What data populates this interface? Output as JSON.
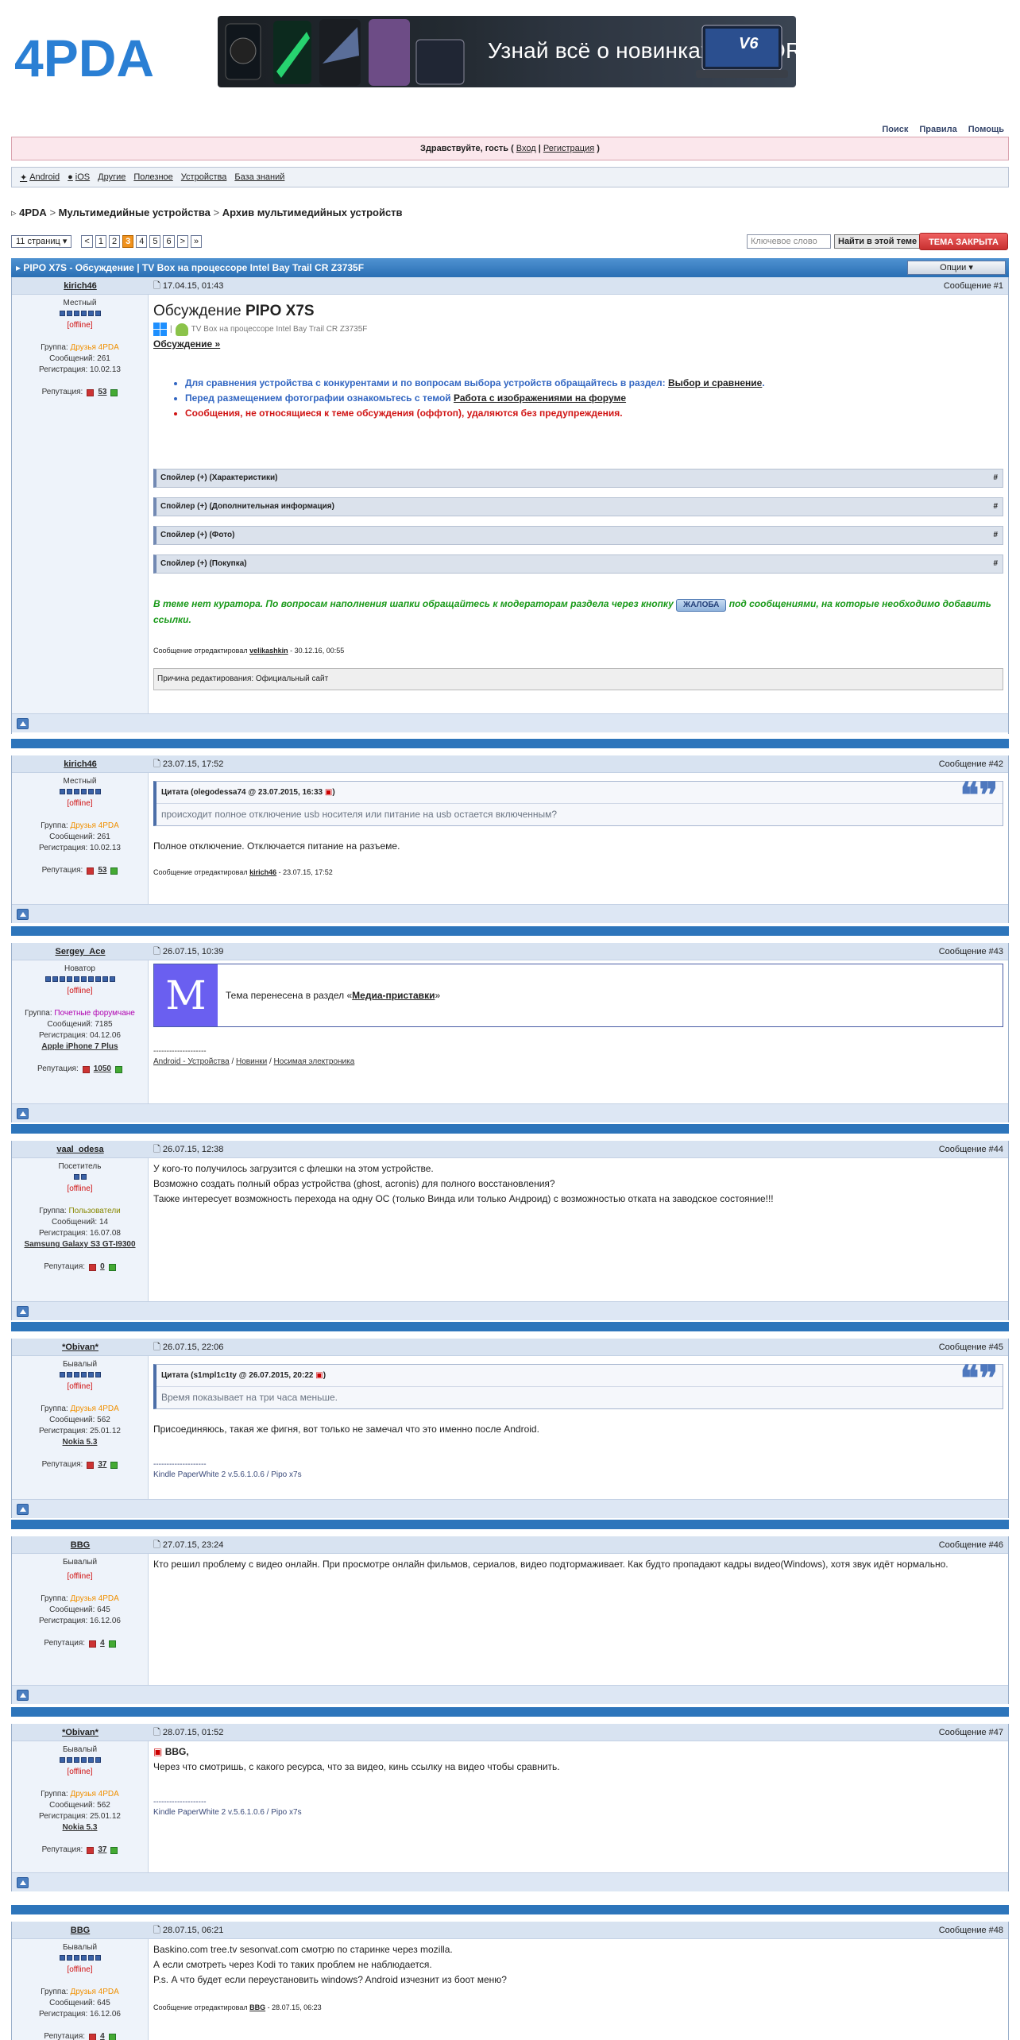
{
  "logo": "4PDA",
  "banner": {
    "text": "Узнай всё о новинках HONOR",
    "badge": "V6"
  },
  "toplinks": [
    "Поиск",
    "Правила",
    "Помощь"
  ],
  "welcome": {
    "prefix": "Здравствуйте, гость ( ",
    "login": "Вход",
    "mid": " | ",
    "register": "Регистрация",
    "suffix": " )"
  },
  "categories": [
    "Android",
    "iOS",
    "Другие",
    "Полезное",
    "Устройства",
    "База знаний"
  ],
  "breadcrumb": [
    "4PDA",
    "Мультимедийные устройства",
    "Архив мультимедийных устройств"
  ],
  "pager": {
    "pages_label": "11 страниц",
    "items": [
      "<",
      "1",
      "2",
      "3",
      "4",
      "5",
      "6",
      ">",
      "»"
    ],
    "current": "3"
  },
  "search": {
    "placeholder": "Ключевое слово",
    "button": "Найти в этой теме"
  },
  "closed_label": "ТЕМА ЗАКРЫТА",
  "topic_title": "PIPO X7S - Обсуждение | TV Box на процессоре Intel Bay Trail CR Z3735F",
  "options_label": "Опции ▾",
  "posts": [
    {
      "user": "kirich46",
      "date": "17.04.15, 01:43",
      "num": "Сообщение #1",
      "rank": "Местный",
      "status": "[offline]",
      "group_label": "Группа: ",
      "group": "Друзья 4PDA",
      "messages": "Сообщений: 261",
      "reg": "Регистрация: 10.02.13",
      "rep_label": "Репутация:",
      "rep": "53",
      "title_plain": "Обсуждение ",
      "title_bold": "PIPO X7S",
      "subtitle": "TV Box на процессоре Intel Bay Trail CR Z3735F",
      "sub_link": "Обсуждение »",
      "bullets": [
        {
          "text": "Для сравнения устройства с конкурентами и по вопросам выбора устройств обращайтесь в раздел: ",
          "link": "Выбор и сравнение",
          "tail": "."
        },
        {
          "text": "Перед размещением фотографии ознакомьтесь с темой ",
          "link": "Работа с изображениями на форуме",
          "tail": ""
        },
        {
          "text": "Сообщения, не относящиеся к теме обсуждения (оффтоп), удаляются без предупреждения.",
          "link": "",
          "tail": ""
        }
      ],
      "spoilers": [
        "Спойлер (+) (Характеристики)",
        "Спойлер (+) (Дополнительная информация)",
        "Спойлер (+) (Фото)",
        "Спойлер (+) (Покупка)"
      ],
      "curator_a": "В теме нет куратора. По вопросам наполнения шапки обращайтесь к модераторам раздела через кнопку ",
      "curator_btn": "ЖАЛОБА",
      "curator_b": " под сообщениями, на которые необходимо добавить ссылки.",
      "edit_prefix": "Сообщение отредактировал ",
      "edit_user": "velikashkin",
      "edit_date": " - 30.12.16, 00:55",
      "reason": "Причина редактирования: Официальный сайт"
    },
    {
      "user": "kirich46",
      "date": "23.07.15, 17:52",
      "num": "Сообщение #42",
      "rank": "Местный",
      "status": "[offline]",
      "group_label": "Группа: ",
      "group": "Друзья 4PDA",
      "messages": "Сообщений: 261",
      "reg": "Регистрация: 10.02.13",
      "rep_label": "Репутация:",
      "rep": "53",
      "quote_head": "Цитата (olegodessa74 @ 23.07.2015, 16:33",
      "quote_body": "происходит полное отключение usb носителя или питание на usb остается включенным?",
      "text": [
        "Полное отключение. Отключается питание на разъеме."
      ],
      "edit_prefix": "Сообщение отредактировал ",
      "edit_user": "kirich46",
      "edit_date": " - 23.07.15, 17:52"
    },
    {
      "user": "Sergey_Ace",
      "date": "26.07.15, 10:39",
      "num": "Сообщение #43",
      "rank": "Новатор",
      "status": "[offline]",
      "group_label": "Группа: ",
      "group": "Почетные форумчане",
      "messages": "Сообщений: 7185",
      "reg": "Регистрация: 04.12.06",
      "device": "Apple iPhone 7 Plus",
      "rep_label": "Репутация:",
      "rep": "1050",
      "moved_letter": "M",
      "moved_text": "Тема перенесена в раздел «",
      "moved_link": "Медиа-приставки",
      "moved_tail": "»",
      "sig_dash": "--------------------",
      "sig_links": [
        "Android - Устройства",
        "Новинки",
        "Носимая электроника"
      ]
    },
    {
      "user": "vaal_odesa",
      "date": "26.07.15, 12:38",
      "num": "Сообщение #44",
      "rank": "Посетитель",
      "status": "[offline]",
      "group_label": "Группа: ",
      "group": "Пользователи",
      "messages": "Сообщений: 14",
      "reg": "Регистрация: 16.07.08",
      "device": "Samsung Galaxy S3 GT-I9300",
      "rep_label": "Репутация:",
      "rep": "0",
      "text": [
        "У кого-то получилось загрузится с флешки на этом устройстве.",
        "Возможно создать полный образ устройства (ghost, acronis) для полного восстановления?",
        "Также интересует возможность перехода на одну ОС (только Винда или только Андроид) с возможностью отката на заводское состояние!!!"
      ]
    },
    {
      "user": "*Obivan*",
      "date": "26.07.15, 22:06",
      "num": "Сообщение #45",
      "rank": "Бывалый",
      "status": "[offline]",
      "group_label": "Группа: ",
      "group": "Друзья 4PDA",
      "messages": "Сообщений: 562",
      "reg": "Регистрация: 25.01.12",
      "device": "Nokia 5.3",
      "rep_label": "Репутация:",
      "rep": "37",
      "quote_head": "Цитата (s1mpl1c1ty @ 26.07.2015, 20:22",
      "quote_body": "Время показывает на три часа меньше.",
      "text": [
        "Присоединяюсь, такая же фигня, вот только не замечал что это именно после Android."
      ],
      "sig_dash": "--------------------",
      "sig": "Kindle PaperWhite 2 v.5.6.1.0.6 / Pipo x7s"
    },
    {
      "user": "BBG",
      "date": "27.07.15, 23:24",
      "num": "Сообщение #46",
      "rank": "Бывалый",
      "status": "[offline]",
      "group_label": "Группа: ",
      "group": "Друзья 4PDA",
      "messages": "Сообщений: 645",
      "reg": "Регистрация: 16.12.06",
      "rep_label": "Репутация:",
      "rep": "4",
      "text": [
        "Кто решил проблему с видео онлайн. При просмотре онлайн фильмов, сериалов, видео подтормаживает. Как будто пропадают кадры видео(Windows), хотя звук идёт нормально."
      ]
    },
    {
      "user": "*Obivan*",
      "date": "28.07.15, 01:52",
      "num": "Сообщение #47",
      "rank": "Бывалый",
      "status": "[offline]",
      "group_label": "Группа: ",
      "group": "Друзья 4PDA",
      "messages": "Сообщений: 562",
      "reg": "Регистрация: 25.01.12",
      "device": "Nokia 5.3",
      "rep_label": "Репутация:",
      "rep": "37",
      "mention": "BBG,",
      "text": [
        "Через что смотришь, с какого ресурса, что за видео, кинь ссылку на видео чтобы сравнить."
      ],
      "sig_dash": "--------------------",
      "sig": "Kindle PaperWhite 2 v.5.6.1.0.6 / Pipo x7s"
    },
    {
      "user": "BBG",
      "date": "28.07.15, 06:21",
      "num": "Сообщение #48",
      "rank": "Бывалый",
      "status": "[offline]",
      "group_label": "Группа: ",
      "group": "Друзья 4PDA",
      "messages": "Сообщений: 645",
      "reg": "Регистрация: 16.12.06",
      "rep_label": "Репутация:",
      "rep": "4",
      "text": [
        "Baskino.com tree.tv sesonvat.com смотрю по старинке через mozilla.",
        "А если смотреть через Kodi то таких проблем не наблюдается.",
        "P.s. А что будет если переустановить windows? Android изчезнит из боот меню?"
      ],
      "edit_prefix": "Сообщение отредактировал ",
      "edit_user": "BBG",
      "edit_date": " - 28.07.15, 06:23"
    }
  ]
}
